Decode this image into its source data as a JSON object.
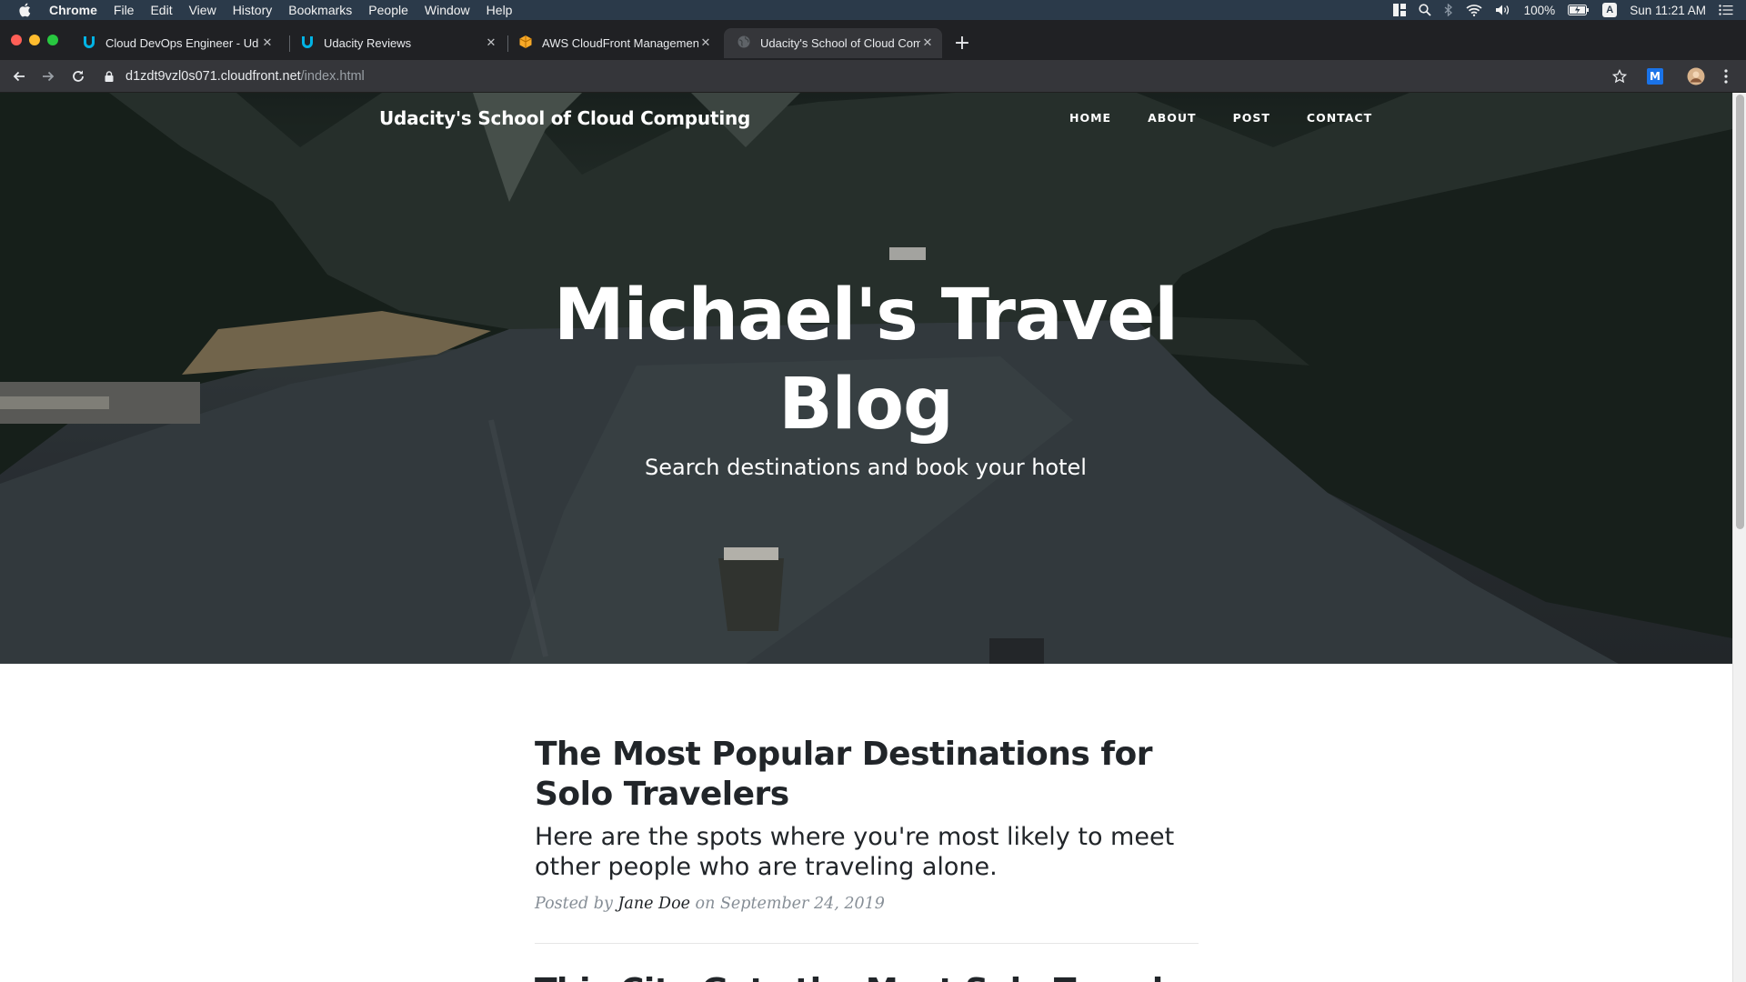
{
  "menubar": {
    "app": "Chrome",
    "items": [
      "File",
      "Edit",
      "View",
      "History",
      "Bookmarks",
      "People",
      "Window",
      "Help"
    ],
    "battery": "100%",
    "input_source": "A",
    "clock": "Sun 11:21 AM"
  },
  "tabs": [
    {
      "title": "Cloud DevOps Engineer - Udacity",
      "icon": "udacity-icon",
      "active": false
    },
    {
      "title": "Udacity Reviews",
      "icon": "udacity-icon",
      "active": false
    },
    {
      "title": "AWS CloudFront Management Console",
      "icon": "aws-icon",
      "active": false
    },
    {
      "title": "Udacity's School of Cloud Computing",
      "icon": "globe-icon",
      "active": true
    }
  ],
  "toolbar": {
    "url_host": "d1zdt9vzl0s071.cloudfront.net",
    "url_path": "/index.html",
    "extension_label": "M"
  },
  "site": {
    "brand": "Udacity's School of Cloud Computing",
    "nav": [
      "HOME",
      "ABOUT",
      "POST",
      "CONTACT"
    ],
    "hero_title": "Michael's Travel Blog",
    "hero_subtitle": "Search destinations and book your hotel"
  },
  "posts": [
    {
      "title": "The Most Popular Destinations for Solo Travelers",
      "subtitle": "Here are the spots where you're most likely to meet other people who are traveling alone.",
      "posted_by_label": "Posted by",
      "author": "Jane Doe",
      "on_label": "on",
      "date": "September 24, 2019"
    },
    {
      "title": "This City Gets the Most Solo Travelers Who...",
      "subtitle": "",
      "posted_by_label": "",
      "author": "",
      "on_label": "",
      "date": ""
    }
  ],
  "colors": {
    "menubar_bg": "#2b3a4a",
    "tabstrip_bg": "#202124",
    "toolbar_bg": "#35363a",
    "text_dark": "#212529",
    "meta_gray": "#868e96"
  }
}
